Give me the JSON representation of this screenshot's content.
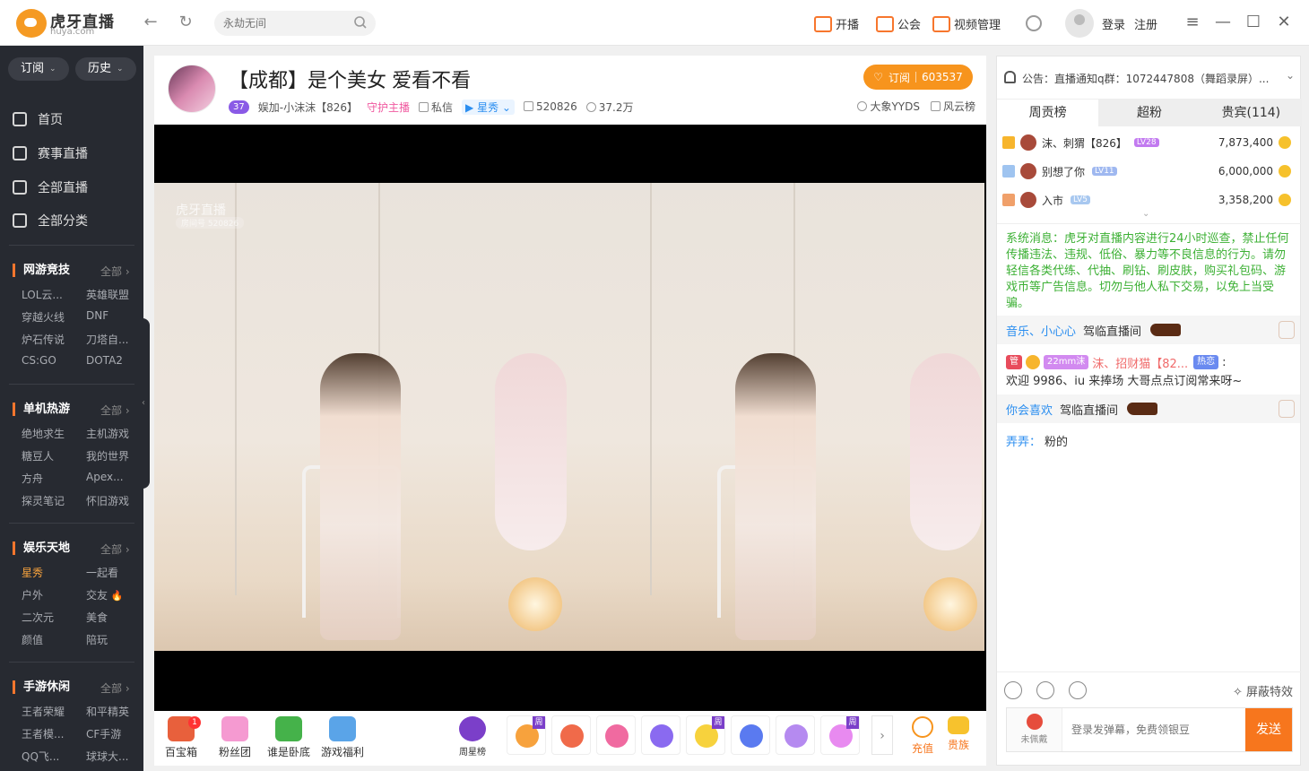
{
  "app": {
    "logo_text": "虎牙直播",
    "logo_sub": "huya.com"
  },
  "search": {
    "placeholder": "永劫无间"
  },
  "topnav": {
    "go_live": "开播",
    "guild": "公会",
    "video_manage": "视频管理",
    "login": "登录",
    "register": "注册"
  },
  "sidebar": {
    "subscribe": "订阅",
    "history": "历史",
    "nav": [
      "首页",
      "赛事直播",
      "全部直播",
      "全部分类"
    ],
    "sections": [
      {
        "title": "网游竞技",
        "all": "全部",
        "items": [
          "LOL云...",
          "英雄联盟",
          "穿越火线",
          "DNF",
          "炉石传说",
          "刀塔自...",
          "CS:GO",
          "DOTA2"
        ]
      },
      {
        "title": "单机热游",
        "all": "全部",
        "items": [
          "绝地求生",
          "主机游戏",
          "糖豆人",
          "我的世界",
          "方舟",
          "Apex...",
          "探灵笔记",
          "怀旧游戏"
        ]
      },
      {
        "title": "娱乐天地",
        "all": "全部",
        "items": [
          "星秀",
          "一起看",
          "户外",
          "交友",
          "二次元",
          "美食",
          "颜值",
          "陪玩"
        ]
      },
      {
        "title": "手游休闲",
        "all": "全部",
        "items": [
          "王者荣耀",
          "和平精英",
          "王者模...",
          "CF手游",
          "QQ飞...",
          "球球大..."
        ]
      }
    ]
  },
  "room": {
    "title": "【成都】是个美女 爱看不看",
    "subscribe_label": "订阅",
    "subscribers": "603537",
    "level": "37",
    "host_name": "娱加-小沫沫【826】",
    "guard": "守护主播",
    "message": "私信",
    "category": "星秀",
    "room_id": "520826",
    "viewers": "37.2万",
    "right_links": [
      "大象YYDS",
      "风云榜"
    ],
    "watermark": "虎牙直播",
    "watermark_id": "房间号 520826"
  },
  "giftbar": {
    "items": [
      {
        "label": "百宝箱",
        "badge": "1"
      },
      {
        "label": "粉丝团"
      },
      {
        "label": "谁是卧底"
      },
      {
        "label": "游戏福利"
      }
    ],
    "week_star": "周星榜",
    "gift_tag": "周",
    "recharge": "充值",
    "noble": "贵族"
  },
  "rpanel": {
    "notice": "公告：直播通知q群：1072447808（舞蹈录屏）...",
    "tabs": [
      "周贡榜",
      "超粉",
      "贵宾(114)"
    ],
    "ranks": [
      {
        "name": "沫、刺猬【826】",
        "lv": "LV28",
        "value": "7,873,400"
      },
      {
        "name": "别想了你",
        "lv": "LV11",
        "value": "6,000,000"
      },
      {
        "name": "入市",
        "lv": "LV5",
        "value": "3,358,200"
      }
    ],
    "system_msg": "系统消息：虎牙对直播内容进行24小时巡查，禁止任何传播违法、违规、低俗、暴力等不良信息的行为。请勿轻信各类代练、代抽、刷钻、刷皮肤，购买礼包码、游戏币等广告信息。切勿与他人私下交易，以免上当受骗。",
    "chats": [
      {
        "name": "音乐、小心心",
        "text": "驾临直播间"
      },
      {
        "tag": "管",
        "fan": "22mm沫",
        "name": "沫、招财猫【82...",
        "hot": "热恋",
        "text": "欢迎 9986、iu 来捧场 大哥点点订阅常来呀~"
      },
      {
        "name": "你会喜欢",
        "text": "驾临直播间"
      },
      {
        "name": "弄弄：",
        "text": "粉的"
      }
    ],
    "block_fx": "屏蔽特效",
    "wear_badge": "未佩戴",
    "input_placeholder": "登录发弹幕，免费领银豆",
    "send": "发送"
  }
}
